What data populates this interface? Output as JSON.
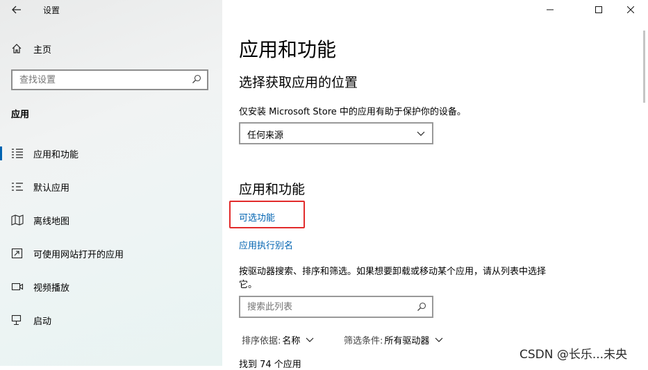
{
  "window": {
    "title": "设置"
  },
  "sidebar": {
    "home_label": "主页",
    "search_placeholder": "查找设置",
    "section_label": "应用",
    "items": [
      {
        "label": "应用和功能",
        "selected": true
      },
      {
        "label": "默认应用",
        "selected": false
      },
      {
        "label": "离线地图",
        "selected": false
      },
      {
        "label": "可使用网站打开的应用",
        "selected": false
      },
      {
        "label": "视频播放",
        "selected": false
      },
      {
        "label": "启动",
        "selected": false
      }
    ]
  },
  "main": {
    "title": "应用和功能",
    "install_section": {
      "heading": "选择获取应用的位置",
      "description": "仅安装 Microsoft Store 中的应用有助于保护你的设备。",
      "source_value": "任何来源"
    },
    "apps_section": {
      "heading": "应用和功能",
      "optional_features_link": "可选功能",
      "aliases_link": "应用执行别名",
      "filter_description": "按驱动器搜索、排序和筛选。如果想要卸载或移动某个应用，请从列表中选择它。",
      "search_placeholder": "搜索此列表",
      "sort_label": "排序依据:",
      "sort_value": "名称",
      "filter_label": "筛选条件:",
      "filter_value": "所有驱动器",
      "count_text": "找到 74 个应用"
    }
  },
  "watermark": "CSDN @长乐...未央",
  "colors": {
    "accent": "#0063b1",
    "highlight": "#e22b2b"
  }
}
